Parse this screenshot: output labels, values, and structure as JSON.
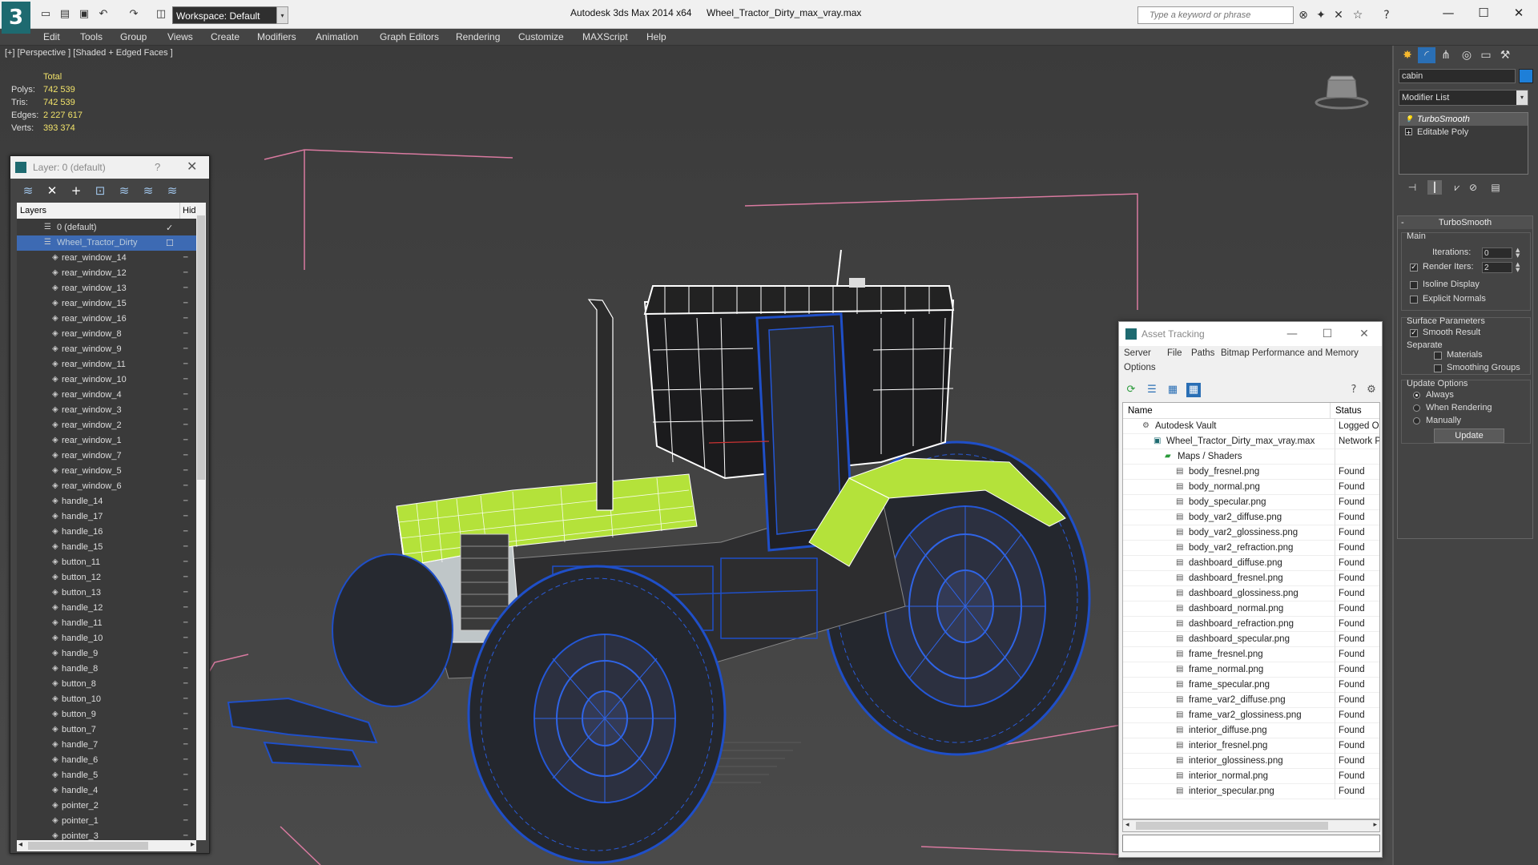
{
  "titlebar": {
    "app_title": "Autodesk 3ds Max  2014 x64",
    "file_title": "Wheel_Tractor_Dirty_max_vray.max",
    "workspace": "Workspace: Default",
    "search_placeholder": "Type a keyword or phrase",
    "logo": "3"
  },
  "menu": [
    "Edit",
    "Tools",
    "Group",
    "Views",
    "Create",
    "Modifiers",
    "Animation",
    "Graph Editors",
    "Rendering",
    "Customize",
    "MAXScript",
    "Help"
  ],
  "viewport": {
    "label": "[+] [Perspective ] [Shaded + Edged Faces ]",
    "stats": {
      "header": "Total",
      "rows": [
        {
          "label": "Polys:",
          "value": "742 539"
        },
        {
          "label": "Tris:",
          "value": "742 539"
        },
        {
          "label": "Edges:",
          "value": "2 227 617"
        },
        {
          "label": "Verts:",
          "value": "393 374"
        }
      ]
    }
  },
  "layer_panel": {
    "title": "Layer: 0 (default)",
    "help": "?",
    "col_layers": "Layers",
    "col_hide": "Hid",
    "rows": [
      {
        "name": "0 (default)",
        "level": 0,
        "selected": false,
        "check": true
      },
      {
        "name": "Wheel_Tractor_Dirty",
        "level": 0,
        "selected": true,
        "check": false
      },
      {
        "name": "rear_window_14",
        "level": 1
      },
      {
        "name": "rear_window_12",
        "level": 1
      },
      {
        "name": "rear_window_13",
        "level": 1
      },
      {
        "name": "rear_window_15",
        "level": 1
      },
      {
        "name": "rear_window_16",
        "level": 1
      },
      {
        "name": "rear_window_8",
        "level": 1
      },
      {
        "name": "rear_window_9",
        "level": 1
      },
      {
        "name": "rear_window_11",
        "level": 1
      },
      {
        "name": "rear_window_10",
        "level": 1
      },
      {
        "name": "rear_window_4",
        "level": 1
      },
      {
        "name": "rear_window_3",
        "level": 1
      },
      {
        "name": "rear_window_2",
        "level": 1
      },
      {
        "name": "rear_window_1",
        "level": 1
      },
      {
        "name": "rear_window_7",
        "level": 1
      },
      {
        "name": "rear_window_5",
        "level": 1
      },
      {
        "name": "rear_window_6",
        "level": 1
      },
      {
        "name": "handle_14",
        "level": 1
      },
      {
        "name": "handle_17",
        "level": 1
      },
      {
        "name": "handle_16",
        "level": 1
      },
      {
        "name": "handle_15",
        "level": 1
      },
      {
        "name": "button_11",
        "level": 1
      },
      {
        "name": "button_12",
        "level": 1
      },
      {
        "name": "button_13",
        "level": 1
      },
      {
        "name": "handle_12",
        "level": 1
      },
      {
        "name": "handle_11",
        "level": 1
      },
      {
        "name": "handle_10",
        "level": 1
      },
      {
        "name": "handle_9",
        "level": 1
      },
      {
        "name": "handle_8",
        "level": 1
      },
      {
        "name": "button_8",
        "level": 1
      },
      {
        "name": "button_10",
        "level": 1
      },
      {
        "name": "button_9",
        "level": 1
      },
      {
        "name": "button_7",
        "level": 1
      },
      {
        "name": "handle_7",
        "level": 1
      },
      {
        "name": "handle_6",
        "level": 1
      },
      {
        "name": "handle_5",
        "level": 1
      },
      {
        "name": "handle_4",
        "level": 1
      },
      {
        "name": "pointer_2",
        "level": 1
      },
      {
        "name": "pointer_1",
        "level": 1
      },
      {
        "name": "pointer_3",
        "level": 1
      }
    ]
  },
  "asset_tracking": {
    "title": "Asset Tracking",
    "menu": [
      "Server",
      "File",
      "Paths",
      "Bitmap Performance and Memory",
      "Options"
    ],
    "col_name": "Name",
    "col_status": "Status",
    "rows": [
      {
        "name": "Autodesk Vault",
        "status": "Logged Ou",
        "level": 0,
        "icon": "vault"
      },
      {
        "name": "Wheel_Tractor_Dirty_max_vray.max",
        "status": "Network P",
        "level": 1,
        "icon": "max"
      },
      {
        "name": "Maps / Shaders",
        "status": "",
        "level": 2,
        "icon": "maps"
      },
      {
        "name": "body_fresnel.png",
        "status": "Found",
        "level": 3,
        "icon": "file"
      },
      {
        "name": "body_normal.png",
        "status": "Found",
        "level": 3,
        "icon": "file"
      },
      {
        "name": "body_specular.png",
        "status": "Found",
        "level": 3,
        "icon": "file"
      },
      {
        "name": "body_var2_diffuse.png",
        "status": "Found",
        "level": 3,
        "icon": "file"
      },
      {
        "name": "body_var2_glossiness.png",
        "status": "Found",
        "level": 3,
        "icon": "file"
      },
      {
        "name": "body_var2_refraction.png",
        "status": "Found",
        "level": 3,
        "icon": "file"
      },
      {
        "name": "dashboard_diffuse.png",
        "status": "Found",
        "level": 3,
        "icon": "file"
      },
      {
        "name": "dashboard_fresnel.png",
        "status": "Found",
        "level": 3,
        "icon": "file"
      },
      {
        "name": "dashboard_glossiness.png",
        "status": "Found",
        "level": 3,
        "icon": "file"
      },
      {
        "name": "dashboard_normal.png",
        "status": "Found",
        "level": 3,
        "icon": "file"
      },
      {
        "name": "dashboard_refraction.png",
        "status": "Found",
        "level": 3,
        "icon": "file"
      },
      {
        "name": "dashboard_specular.png",
        "status": "Found",
        "level": 3,
        "icon": "file"
      },
      {
        "name": "frame_fresnel.png",
        "status": "Found",
        "level": 3,
        "icon": "file"
      },
      {
        "name": "frame_normal.png",
        "status": "Found",
        "level": 3,
        "icon": "file"
      },
      {
        "name": "frame_specular.png",
        "status": "Found",
        "level": 3,
        "icon": "file"
      },
      {
        "name": "frame_var2_diffuse.png",
        "status": "Found",
        "level": 3,
        "icon": "file"
      },
      {
        "name": "frame_var2_glossiness.png",
        "status": "Found",
        "level": 3,
        "icon": "file"
      },
      {
        "name": "interior_diffuse.png",
        "status": "Found",
        "level": 3,
        "icon": "file"
      },
      {
        "name": "interior_fresnel.png",
        "status": "Found",
        "level": 3,
        "icon": "file"
      },
      {
        "name": "interior_glossiness.png",
        "status": "Found",
        "level": 3,
        "icon": "file"
      },
      {
        "name": "interior_normal.png",
        "status": "Found",
        "level": 3,
        "icon": "file"
      },
      {
        "name": "interior_specular.png",
        "status": "Found",
        "level": 3,
        "icon": "file"
      }
    ]
  },
  "command_panel": {
    "object_name": "cabin",
    "object_color": "#1e7fd8",
    "modifier_list": "Modifier List",
    "stack": [
      {
        "name": "TurboSmooth",
        "active": true
      },
      {
        "name": "Editable Poly",
        "active": false
      }
    ],
    "turbosmooth": {
      "title": "TurboSmooth",
      "main": "Main",
      "iterations_label": "Iterations:",
      "iterations": "0",
      "render_iters_label": "Render Iters:",
      "render_iters": "2",
      "isoline": "Isoline Display",
      "explicit": "Explicit Normals",
      "surface": "Surface Parameters",
      "smooth_result": "Smooth Result",
      "separate": "Separate",
      "materials": "Materials",
      "smoothing_groups": "Smoothing Groups",
      "update_options": "Update Options",
      "always": "Always",
      "when_rendering": "When Rendering",
      "manually": "Manually",
      "update": "Update"
    }
  },
  "colors": {
    "selection": "#3d6ab3",
    "accent_teal": "#1e6a70",
    "stats_yellow": "#f2e36a",
    "wire_blue": "#1f4fc8",
    "wire_green": "#b4e23a",
    "bbox_pink": "#d97aa0"
  }
}
